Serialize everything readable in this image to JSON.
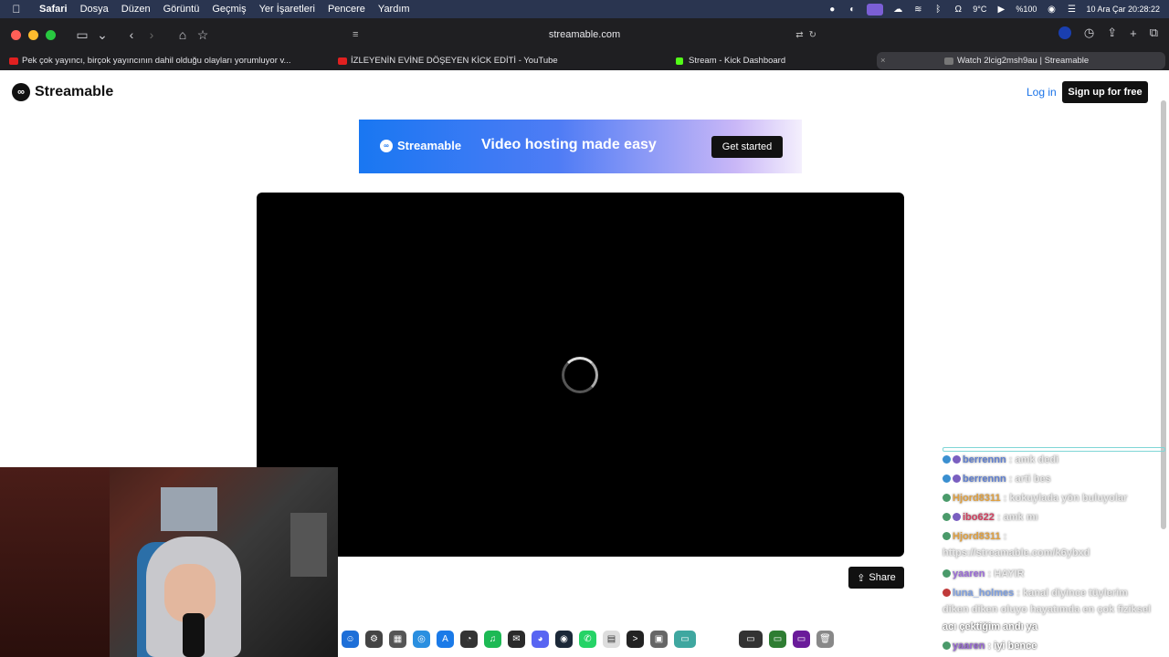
{
  "menubar": {
    "app": "Safari",
    "items": [
      "Dosya",
      "Düzen",
      "Görüntü",
      "Geçmiş",
      "Yer İşaretleri",
      "Pencere",
      "Yardım"
    ],
    "weather": "9°C",
    "battery": "%100",
    "datetime": "10 Ara Çar  20:28:22"
  },
  "browser": {
    "address": "streamable.com",
    "tabs": [
      {
        "title": "Pek çok yayıncı, birçok yayıncının dahil olduğu olayları yorumluyor v..."
      },
      {
        "title": "İZLEYENİN EVİNE DÖŞEYEN KİCK EDİTİ - YouTube"
      },
      {
        "title": "Stream - Kick Dashboard"
      },
      {
        "title": "Watch 2lcig2msh9au | Streamable"
      }
    ]
  },
  "page": {
    "brand": "Streamable",
    "login": "Log in",
    "signup": "Sign up for free",
    "banner": {
      "brand": "Streamable",
      "tagline": "Video hosting made easy",
      "cta": "Get started"
    },
    "share": "Share"
  },
  "chat": {
    "messages": [
      {
        "user": "berrennn",
        "text": " : amk dedi",
        "color": "#5f7fd0"
      },
      {
        "user": "berrennn",
        "text": " : arti bes",
        "color": "#5f7fd0"
      },
      {
        "user": "Hjord8311",
        "text": " : kokuylada yön buluyolar",
        "color": "#e0a040"
      },
      {
        "user": "ibo622",
        "text": " : amk mı",
        "color": "#d04060"
      },
      {
        "user": "Hjord8311",
        "text": " :",
        "color": "#e0a040"
      },
      {
        "user": "",
        "text": "https://streamable.com/k6ybxd",
        "color": ""
      },
      {
        "user": "yaaren",
        "text": " : HAYIR",
        "color": "#9b6bd8"
      },
      {
        "user": "luna_holmes",
        "text": " : kanal diyince tüylerim",
        "color": "#7fa0e0"
      },
      {
        "user": "",
        "text": "diken diken oluyo hayatımda en çok fiziksel",
        "color": ""
      },
      {
        "user": "",
        "text": "acı çektiğim andı ya",
        "color": ""
      },
      {
        "user": "yaaren",
        "text": " : iyi bence",
        "color": "#9b6bd8"
      }
    ]
  }
}
